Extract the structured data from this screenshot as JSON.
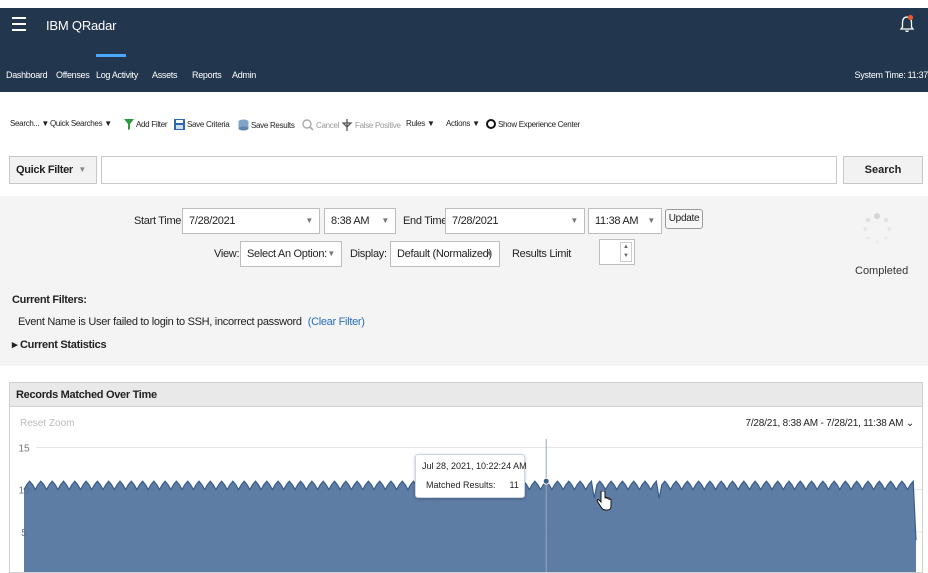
{
  "app": {
    "title": "IBM QRadar"
  },
  "nav": {
    "items": [
      "Dashboard",
      "Offenses",
      "Log Activity",
      "Assets",
      "Reports",
      "Admin"
    ],
    "active": "Log Activity",
    "system_time": "System Time: 11:37"
  },
  "toolbar": {
    "search": "Search...",
    "quick_searches": "Quick Searches",
    "add_filter": "Add Filter",
    "save_criteria": "Save Criteria",
    "save_results": "Save Results",
    "cancel": "Cancel",
    "false_positive": "False Positive",
    "rules": "Rules",
    "actions": "Actions",
    "show_experience_center": "Show Experience Center"
  },
  "quick_filter": {
    "selected": "Quick Filter",
    "value": "",
    "search_label": "Search"
  },
  "time_range": {
    "start_label": "Start Time",
    "start_date": "7/28/2021",
    "start_time": "8:38 AM",
    "end_label": "End Time",
    "end_date": "7/28/2021",
    "end_time": "11:38 AM",
    "update_label": "Update"
  },
  "view": {
    "view_label": "View:",
    "view_value": "Select An Option:",
    "display_label": "Display:",
    "display_value": "Default (Normalized)",
    "results_limit_label": "Results Limit",
    "results_limit_value": ""
  },
  "status": {
    "text": "Completed"
  },
  "filters": {
    "title": "Current Filters:",
    "items": [
      {
        "text": "Event Name is User failed to login to SSH, incorrect password",
        "clear_label": "(Clear Filter)"
      }
    ],
    "statistics_label": "Current Statistics"
  },
  "chart_panel": {
    "title": "Records Matched Over Time",
    "reset_zoom": "Reset Zoom",
    "range_label": "7/28/21, 8:38 AM - 7/28/21, 11:38 AM"
  },
  "colors": {
    "header_bg": "#22364d",
    "area_fill": "#4d6f9b",
    "area_line": "#3a5d8c",
    "link": "#2a6ebb",
    "alert": "#e8572f"
  },
  "chart_data": {
    "type": "area",
    "title": "Records Matched Over Time",
    "series": [
      {
        "name": "Matched Results",
        "values": [
          10,
          10.6,
          11,
          10.6,
          10,
          10.6,
          11,
          10.6,
          10,
          10.6,
          11,
          10.6,
          10,
          10.6,
          11,
          10.6,
          10,
          10.6,
          11,
          10.6,
          10,
          10.6,
          11,
          10.6,
          10,
          10.6,
          11,
          10.6,
          10,
          10.6,
          11,
          10.6,
          10,
          10.6,
          11,
          10.6,
          10,
          10.6,
          11,
          10.6,
          10,
          10.6,
          11,
          10.6,
          10,
          10.6,
          11,
          10.6,
          10,
          10.6,
          11,
          10.6,
          10,
          10.6,
          11,
          10.6,
          10,
          10.6,
          11,
          10.6,
          10,
          10.6,
          11,
          10.6,
          10,
          10.6,
          11,
          10.6,
          10,
          10.6,
          11,
          10.6,
          10,
          10.6,
          11,
          10.6,
          10,
          10.6,
          11,
          10.6,
          10,
          10.6,
          11,
          10.6,
          10,
          10.6,
          11,
          10.6,
          10,
          10.6,
          11,
          10.6,
          10,
          10.6,
          11,
          10.6,
          10,
          10.6,
          11,
          10.6,
          10,
          10.6,
          11,
          10.6,
          10,
          10.6,
          11,
          10.6,
          10,
          10.6,
          11,
          10.6,
          10,
          10.6,
          11,
          10.6,
          10,
          10.6,
          11,
          10.6,
          10,
          10.6,
          11,
          10.6,
          10,
          10.6,
          11,
          10.6,
          10,
          10.6,
          11,
          10.6,
          10,
          10.6,
          11,
          10.6,
          10,
          10.6,
          11,
          10.6,
          10,
          10.6,
          11,
          10.6,
          10,
          10.6,
          11,
          9,
          10.6,
          11,
          10.6,
          10,
          10.6,
          11,
          10.6,
          10,
          10.6,
          11,
          10.6,
          10,
          10.6,
          11,
          10.6,
          10,
          10.6,
          11,
          10.6,
          10,
          10.6,
          11,
          10.6,
          10,
          10.6,
          11,
          10.6,
          10,
          10.6,
          11,
          10.6,
          10,
          10.6,
          11,
          10.6,
          10,
          10.6,
          11,
          10.6,
          10,
          10.6,
          11,
          10.6,
          10,
          10.6,
          11,
          10.6,
          10,
          10.6,
          11,
          10.6,
          10,
          10.6,
          11,
          9,
          10.6,
          11,
          10.6,
          10,
          10.6,
          11,
          10.6,
          10,
          10.6,
          11,
          10.6,
          10,
          10.6,
          11,
          10.6,
          10,
          10.6,
          11,
          10.6,
          10,
          10.6,
          11,
          9,
          10.6,
          11,
          10.6,
          10,
          10.6,
          11,
          10.6,
          10,
          10.6,
          11,
          10.6,
          10,
          10.6,
          11,
          10.6,
          10,
          10.6,
          11,
          10.6,
          10,
          10.6,
          11,
          10.6,
          10,
          10.6,
          11,
          10.6,
          10,
          10.6,
          11,
          10.6,
          10,
          10.6,
          11,
          10.6,
          10,
          10.6,
          11,
          10.6,
          10,
          10.6,
          11,
          10.6,
          10,
          10.6,
          11,
          10.6,
          10,
          10.6,
          11,
          10.6,
          10,
          10.6,
          11,
          10.6,
          10,
          10.6,
          11,
          10.6,
          10,
          10.6,
          11,
          10.6,
          10,
          10.6,
          11,
          10.6,
          10,
          10.6,
          11,
          10.6,
          10,
          10.6,
          11,
          10.6,
          10,
          10.6,
          11,
          10.6,
          10,
          10.6,
          11,
          10.6,
          10,
          10.6,
          11,
          10.6,
          10,
          10.6,
          11,
          4
        ]
      }
    ],
    "y_ticks": [
      15,
      10,
      5
    ],
    "ylim": [
      0,
      16
    ],
    "grid": true,
    "highlighted_point": {
      "label": "Jul 28, 2021, 10:22:24 AM",
      "series_label": "Matched Results:",
      "value": 11
    }
  }
}
